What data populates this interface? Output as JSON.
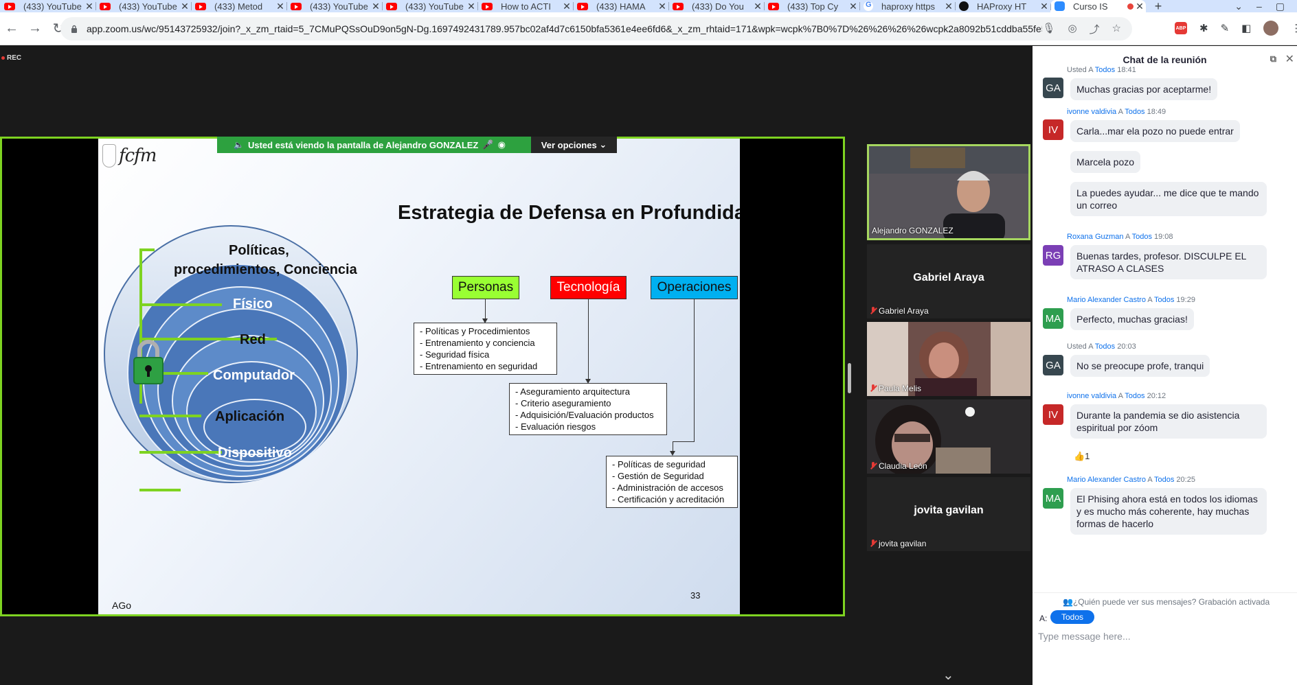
{
  "browser": {
    "tabs": [
      {
        "label": "(433) YouTube",
        "icon": "youtube-icon"
      },
      {
        "label": "(433) YouTube",
        "icon": "youtube-icon"
      },
      {
        "label": "(433) Metod",
        "icon": "youtube-icon"
      },
      {
        "label": "(433) YouTube",
        "icon": "youtube-icon"
      },
      {
        "label": "(433) YouTube",
        "icon": "youtube-icon"
      },
      {
        "label": "How to ACTI",
        "icon": "youtube-icon"
      },
      {
        "label": "(433) HAMA",
        "icon": "youtube-icon"
      },
      {
        "label": "(433) Do You",
        "icon": "youtube-icon"
      },
      {
        "label": "(433) Top Cy",
        "icon": "youtube-icon"
      },
      {
        "label": "haproxy https",
        "icon": "google-icon"
      },
      {
        "label": "HAProxy HT",
        "icon": "github-icon"
      },
      {
        "label": "Curso IS",
        "icon": "zoom-icon"
      }
    ],
    "url": "app.zoom.us/wc/95143725932/join?_x_zm_rtaid=5_7CMuPQSsOuD9on5gN-Dg.1697492431789.957bc02af4d7c6150bfa5361e4ee6fd6&_x_zm_rhtaid=171&wpk=wcpk%7B0%7D%26%26%26%26wcpk2a8092b51cddba55fe596..."
  },
  "meeting": {
    "rec_label": "REC",
    "share_banner": "Usted está viendo la pantalla de  Alejandro GONZALEZ",
    "view_options": "Ver opciones"
  },
  "slide": {
    "logo_text": "fcfm",
    "title": "Estrategia de Defensa en Profundidad",
    "layers": [
      "Políticas,",
      "procedimientos, Conciencia",
      "Físico",
      "Red",
      "Computador",
      "Aplicación",
      "Dispositivo"
    ],
    "boxes": {
      "personas": {
        "title": "Personas",
        "color": "#99ff33",
        "items": [
          "Políticas y Procedimientos",
          "Entrenamiento y conciencia",
          "Seguridad física",
          "Entrenamiento en seguridad"
        ]
      },
      "tecnologia": {
        "title": "Tecnología",
        "color": "#ff0000",
        "items": [
          "Aseguramiento arquitectura",
          "Criterio aseguramiento",
          "Adquisición/Evaluación productos",
          "Evaluación riesgos"
        ]
      },
      "operaciones": {
        "title": "Operaciones",
        "color": "#00b0f0",
        "items": [
          "Políticas de seguridad",
          "Gestión de Seguridad",
          "Administración de accesos",
          "Certificación y acreditación"
        ]
      }
    },
    "page_number": "33",
    "author": "AGo"
  },
  "participants": [
    {
      "name": "Alejandro GONZALEZ",
      "video": true,
      "muted": false,
      "speaking": true
    },
    {
      "name": "Gabriel Araya",
      "video": false,
      "muted": true
    },
    {
      "name": "Paula Melis",
      "video": true,
      "muted": true
    },
    {
      "name": "Claudia León",
      "video": true,
      "muted": true
    },
    {
      "name": "jovita gavilan",
      "video": false,
      "muted": true
    }
  ],
  "chat": {
    "title": "Chat de la reunión",
    "messages": [
      {
        "sender": "Usted",
        "to": "Todos",
        "time": "18:41",
        "initials": "GA",
        "avatar_color": "#37474f",
        "texts": [
          "Muchas gracias por aceptarme!"
        ]
      },
      {
        "sender": "ivonne valdivia",
        "to": "Todos",
        "time": "18:49",
        "initials": "IV",
        "avatar_color": "#c62828",
        "texts": [
          "Carla...mar ela pozo no puede entrar",
          "Marcela pozo",
          "La puedes ayudar... me dice que  te mando un correo"
        ]
      },
      {
        "sender": "Roxana Guzman",
        "to": "Todos",
        "time": "19:08",
        "initials": "RG",
        "avatar_color": "#7b3fb5",
        "texts": [
          "Buenas tardes, profesor. DISCULPE EL ATRASO A CLASES"
        ]
      },
      {
        "sender": "Mario Alexander Castro",
        "to": "Todos",
        "time": "19:29",
        "initials": "MA",
        "avatar_color": "#2e9e4f",
        "texts": [
          "Perfecto, muchas gracias!"
        ]
      },
      {
        "sender": "Usted",
        "to": "Todos",
        "time": "20:03",
        "initials": "GA",
        "avatar_color": "#37474f",
        "texts": [
          "No se preocupe profe, tranqui"
        ]
      },
      {
        "sender": "ivonne valdivia",
        "to": "Todos",
        "time": "20:12",
        "initials": "IV",
        "avatar_color": "#c62828",
        "texts": [
          "Durante la pandemia se dio asistencia espiritual por zóom"
        ],
        "reaction": "👍1"
      },
      {
        "sender": "Mario Alexander Castro",
        "to": "Todos",
        "time": "20:25",
        "initials": "MA",
        "avatar_color": "#2e9e4f",
        "texts": [
          "El Phising ahora está en todos los idiomas y es mucho más coherente, hay muchas formas de hacerlo"
        ]
      }
    ],
    "to_word": "A",
    "visibility_note": "¿Quién puede ver sus mensajes? Grabación activada",
    "to_label": "A:",
    "to_value": "Todos",
    "input_placeholder": "Type message here..."
  }
}
